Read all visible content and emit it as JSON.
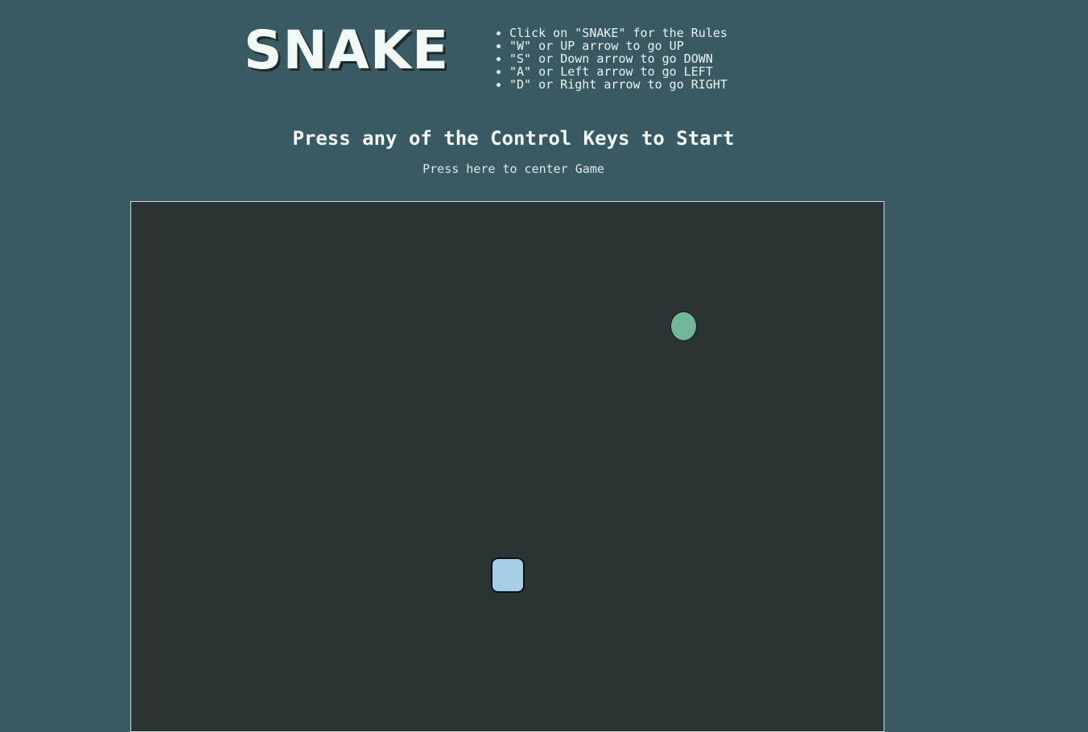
{
  "header": {
    "title": "SNAKE",
    "rules": [
      "Click on \"SNAKE\" for the Rules",
      "\"W\" or UP arrow to go UP",
      "\"S\" or Down arrow to go DOWN",
      "\"A\" or Left arrow to go LEFT",
      "\"D\" or Right arrow to go RIGHT"
    ]
  },
  "status": {
    "start_message": "Press any of the Control Keys to Start",
    "center_link": "Press here to center Game"
  },
  "game": {
    "colors": {
      "page_background": "#3a5a63",
      "board_background": "#2b3333",
      "food": "#73b597",
      "snake": "#a5cfe6"
    }
  }
}
